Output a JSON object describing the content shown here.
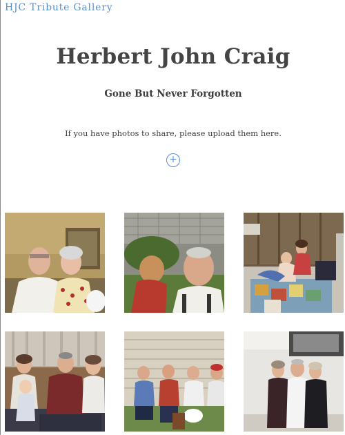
{
  "header": {
    "site_title": "HJC Tribute Gallery"
  },
  "hero": {
    "name": "Herbert John Craig",
    "subtitle": "Gone But Never Forgotten",
    "upload_prompt": "If you have photos to share, please upload them here.",
    "upload_button_symbol": "+"
  },
  "gallery": {
    "photos": [
      {
        "icon": "photo-couple-indoors"
      },
      {
        "icon": "photo-man-child-outdoors"
      },
      {
        "icon": "photo-children-on-bed"
      },
      {
        "icon": "photo-family-on-sofa"
      },
      {
        "icon": "photo-men-outdoors-chairs"
      },
      {
        "icon": "photo-three-people-standing"
      }
    ]
  },
  "colors": {
    "accent": "#5a8fd0",
    "text": "#3d3d3d"
  }
}
